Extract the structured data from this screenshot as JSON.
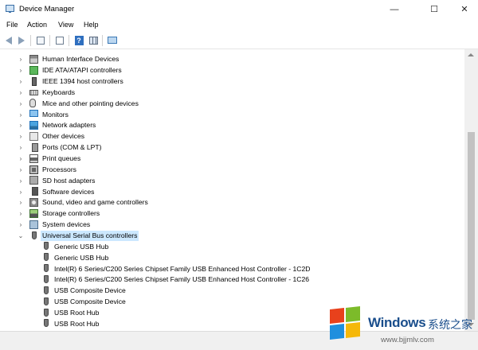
{
  "window": {
    "title": "Device Manager",
    "controls": {
      "minimize": "—",
      "maximize": "☐",
      "close": "✕"
    }
  },
  "menu": [
    "File",
    "Action",
    "View",
    "Help"
  ],
  "toolbar": {
    "buttons": [
      "back-arrow-icon",
      "forward-arrow-icon",
      "properties-icon",
      "details-icon",
      "help-icon",
      "grid-icon",
      "monitor-icon"
    ]
  },
  "tree": {
    "categories": [
      {
        "label": "Human Interface Devices",
        "icon": "hid"
      },
      {
        "label": "IDE ATA/ATAPI controllers",
        "icon": "ide"
      },
      {
        "label": "IEEE 1394 host controllers",
        "icon": "1394"
      },
      {
        "label": "Keyboards",
        "icon": "kbd"
      },
      {
        "label": "Mice and other pointing devices",
        "icon": "mouse"
      },
      {
        "label": "Monitors",
        "icon": "mon"
      },
      {
        "label": "Network adapters",
        "icon": "net"
      },
      {
        "label": "Other devices",
        "icon": "other"
      },
      {
        "label": "Ports (COM & LPT)",
        "icon": "port"
      },
      {
        "label": "Print queues",
        "icon": "print"
      },
      {
        "label": "Processors",
        "icon": "cpu"
      },
      {
        "label": "SD host adapters",
        "icon": "sd"
      },
      {
        "label": "Software devices",
        "icon": "sw"
      },
      {
        "label": "Sound, video and game controllers",
        "icon": "sound"
      },
      {
        "label": "Storage controllers",
        "icon": "stor"
      },
      {
        "label": "System devices",
        "icon": "sys"
      },
      {
        "label": "Universal Serial Bus controllers",
        "icon": "usb",
        "expanded": true,
        "selected": true
      }
    ],
    "usb_children": [
      "Generic USB Hub",
      "Generic USB Hub",
      "Intel(R) 6 Series/C200 Series Chipset Family USB Enhanced Host Controller - 1C2D",
      "Intel(R) 6 Series/C200 Series Chipset Family USB Enhanced Host Controller - 1C26",
      "USB Composite Device",
      "USB Composite Device",
      "USB Root Hub",
      "USB Root Hub"
    ]
  },
  "watermark": {
    "brand": "Windows",
    "brand_cn": "系统之家",
    "url": "www.bjjmlv.com",
    "colors": {
      "red": "#e8411c",
      "green": "#7cbb2a",
      "blue": "#1f8fde",
      "yellow": "#f5b80a"
    }
  }
}
